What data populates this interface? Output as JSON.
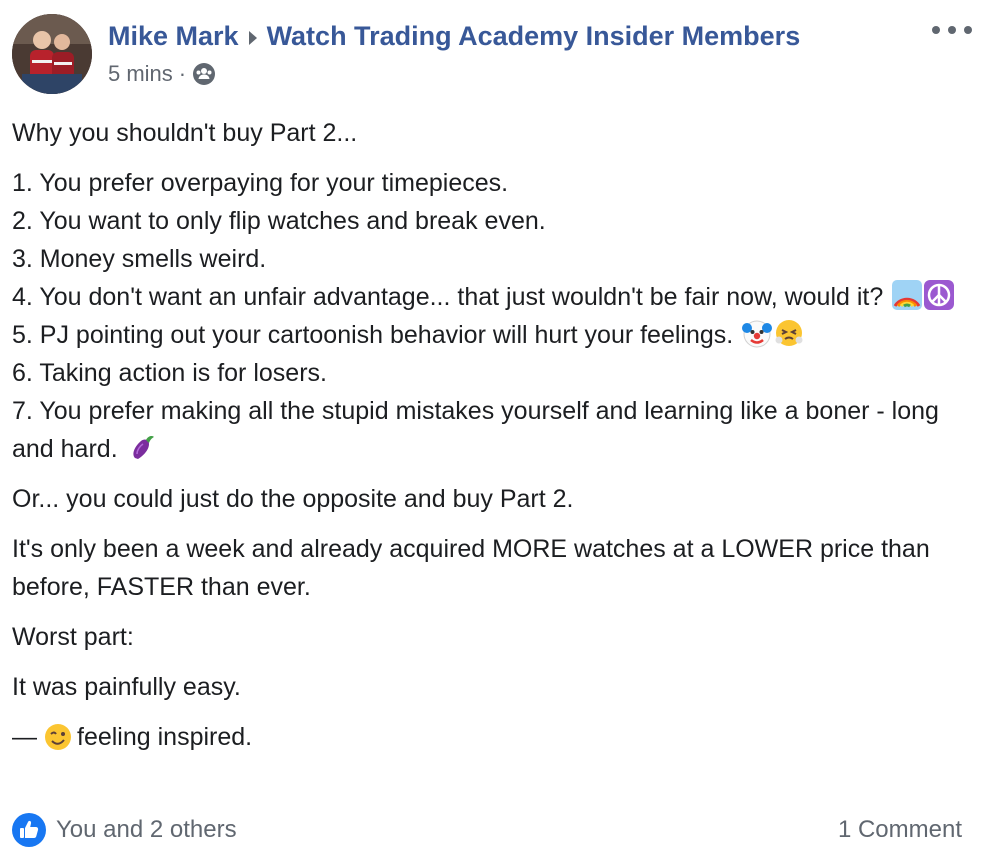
{
  "header": {
    "author": "Mike Mark",
    "group": "Watch Trading Academy Insider Members",
    "timestamp": "5 mins",
    "separator": "·",
    "audience_icon": "group-icon",
    "more_icon": "more-horizontal-icon"
  },
  "post": {
    "intro": "Why you shouldn't buy Part 2...",
    "list": [
      {
        "text": "1. You prefer overpaying for your timepieces.",
        "emojis": []
      },
      {
        "text": "2. You want to only flip watches and break even.",
        "emojis": []
      },
      {
        "text": "3. Money smells weird.",
        "emojis": []
      },
      {
        "text": "4. You don't want an unfair advantage... that just wouldn't be fair now, would it?",
        "emojis": [
          "rainbow-emoji",
          "peace-sign-emoji"
        ]
      },
      {
        "text": "5. PJ pointing out your cartoonish behavior will hurt your feelings.",
        "emojis": [
          "clown-face-emoji",
          "face-with-steam-emoji"
        ]
      },
      {
        "text": "6. Taking action is for losers.",
        "emojis": []
      },
      {
        "text": "7. You prefer making all the stupid mistakes yourself and learning like a boner - long and hard.",
        "emojis": [
          "eggplant-emoji"
        ]
      }
    ],
    "para_opposite": "Or... you could just do the opposite and buy Part 2.",
    "para_week": "It's only been a week and already acquired MORE watches at a LOWER price than before, FASTER than ever.",
    "para_worst": "Worst part:",
    "para_easy": "It was painfully easy.",
    "feeling_dash": "—",
    "feeling_text": "feeling inspired.",
    "feeling_emoji": "winking-face-emoji"
  },
  "footer": {
    "reaction_icon": "like-icon",
    "reactions_text": "You and 2 others",
    "comments_text": "1 Comment"
  },
  "colors": {
    "link_blue": "#385898",
    "text": "#1c1e21",
    "meta_gray": "#616770",
    "like_blue": "#1877f2"
  }
}
